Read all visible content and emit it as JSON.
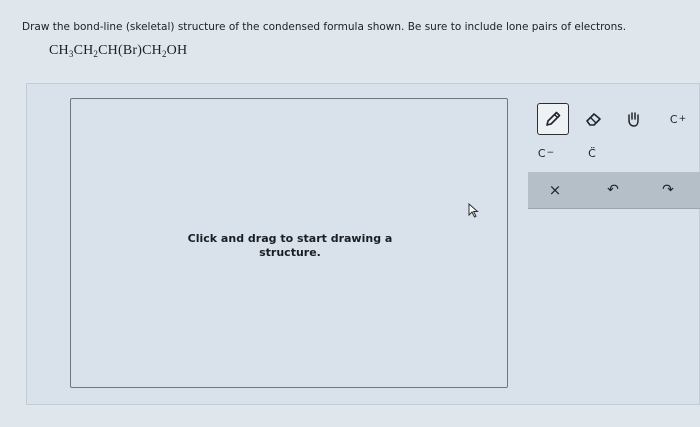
{
  "question": {
    "prompt": "Draw the bond-line (skeletal) structure of the condensed formula shown. Be sure to include lone pairs of electrons.",
    "formula_parts": [
      "CH",
      "3",
      "CH",
      "2",
      "CH(Br)CH",
      "2",
      "OH"
    ]
  },
  "canvas": {
    "hint": "Click and drag to start drawing a structure."
  },
  "toolbar": {
    "tools": [
      {
        "name": "pencil-icon",
        "label": ""
      },
      {
        "name": "eraser-icon",
        "label": ""
      },
      {
        "name": "hand-icon",
        "label": ""
      },
      {
        "name": "carbocation",
        "label": "C",
        "sup": "+"
      },
      {
        "name": "carbanion",
        "label": "C",
        "sup": "−"
      },
      {
        "name": "lone-pair",
        "label": "C̈"
      }
    ],
    "actions": [
      {
        "name": "clear-icon",
        "label": "×"
      },
      {
        "name": "undo-icon",
        "label": "↶"
      },
      {
        "name": "redo-icon",
        "label": "↷"
      }
    ]
  }
}
